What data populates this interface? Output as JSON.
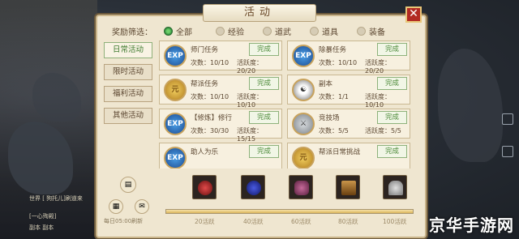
{
  "window": {
    "title": "活动",
    "close_label": "✕"
  },
  "filter": {
    "label": "奖励筛选：",
    "options": [
      {
        "label": "全部",
        "selected": true
      },
      {
        "label": "经验",
        "selected": false
      },
      {
        "label": "道武",
        "selected": false
      },
      {
        "label": "道具",
        "selected": false
      },
      {
        "label": "装备",
        "selected": false
      }
    ]
  },
  "tabs": [
    {
      "label": "日常活动",
      "active": true
    },
    {
      "label": "限时活动",
      "active": false
    },
    {
      "label": "福利活动",
      "active": false
    },
    {
      "label": "其他活动",
      "active": false
    }
  ],
  "activities": [
    {
      "name": "师门任务",
      "count": "次数：10/10",
      "activity": "活跃度：20/20",
      "status": "完成",
      "icon": "exp-icon"
    },
    {
      "name": "除暴任务",
      "count": "次数：10/10",
      "activity": "活跃度：20/20",
      "status": "完成",
      "icon": "exp-icon"
    },
    {
      "name": "帮派任务",
      "count": "次数：10/10",
      "activity": "活跃度：10/10",
      "status": "完成",
      "icon": "coin-icon"
    },
    {
      "name": "副本",
      "count": "次数：1/1",
      "activity": "活跃度：10/10",
      "status": "完成",
      "icon": "yinyang-exp-icon"
    },
    {
      "name": "【修炼】修行",
      "count": "次数：30/30",
      "activity": "活跃度：15/15",
      "status": "完成",
      "icon": "exp-icon"
    },
    {
      "name": "竞技场",
      "count": "次数：5/5",
      "activity": "活跃度：5/5",
      "status": "完成",
      "icon": "crossed-swords-icon"
    },
    {
      "name": "助人为乐",
      "count": "",
      "activity": "",
      "status": "完成",
      "icon": "exp-icon"
    },
    {
      "name": "帮派日常挑战",
      "count": "",
      "activity": "",
      "status": "完成",
      "icon": "coin-icon"
    }
  ],
  "rewards": {
    "daily_reset_label": "每日05:00刷新",
    "progress_fraction": 1.0,
    "milestones": [
      "20活跃",
      "40活跃",
      "60活跃",
      "80活跃",
      "100活跃"
    ]
  },
  "chat": {
    "line1": "世界 [   狗托儿]刷道来",
    "line2": "[一心殉殿]",
    "line3": "副本    副本"
  },
  "watermark": "京华手游网"
}
